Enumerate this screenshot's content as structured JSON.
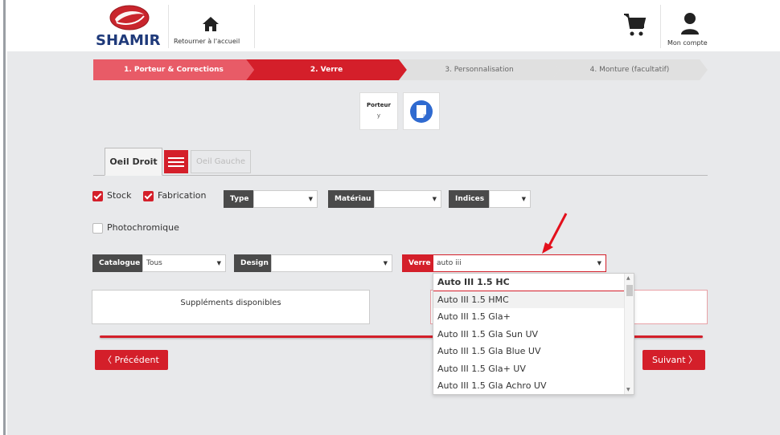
{
  "header": {
    "brand": "SHAMIR",
    "home_label": "Retourner à l'accueil",
    "account_label": "Mon compte"
  },
  "steps": [
    {
      "label": "1. Porteur & Corrections"
    },
    {
      "label": "2. Verre"
    },
    {
      "label": "3. Personnalisation"
    },
    {
      "label": "4. Monture (facultatif)"
    }
  ],
  "porteur": {
    "title": "Porteur",
    "value": "y"
  },
  "tabs": {
    "droit": "Oeil Droit",
    "gauche": "Oeil Gauche"
  },
  "filters": {
    "stock": {
      "label": "Stock",
      "checked": true
    },
    "fabrication": {
      "label": "Fabrication",
      "checked": true
    },
    "photochromique": {
      "label": "Photochromique",
      "checked": false
    },
    "type": {
      "label": "Type",
      "value": ""
    },
    "materiau": {
      "label": "Matériau",
      "value": ""
    },
    "indices": {
      "label": "Indices",
      "value": ""
    },
    "catalogue": {
      "label": "Catalogue",
      "value": "Tous"
    },
    "design": {
      "label": "Design",
      "value": ""
    },
    "verre": {
      "label": "Verre",
      "value": "auto iii"
    }
  },
  "dropdown": {
    "items": [
      "Auto III 1.5 HC",
      "Auto III 1.5 HMC",
      "Auto III 1.5 Gla+",
      "Auto III 1.5 Gla Sun UV",
      "Auto III 1.5 Gla Blue UV",
      "Auto III 1.5 Gla+ UV",
      "Auto III 1.5 Gla Achro UV"
    ]
  },
  "supplements": {
    "label": "Suppléments disponibles"
  },
  "nav": {
    "prev": "Précédent",
    "next": "Suivant"
  },
  "colors": {
    "accent": "#d41f2a",
    "step_done": "#e85b67",
    "brand_blue": "#1f3a7a"
  },
  "icons": [
    "home-icon",
    "cart-icon",
    "user-icon",
    "note-icon",
    "menu-icon",
    "chevron-left-icon",
    "chevron-right-icon"
  ]
}
